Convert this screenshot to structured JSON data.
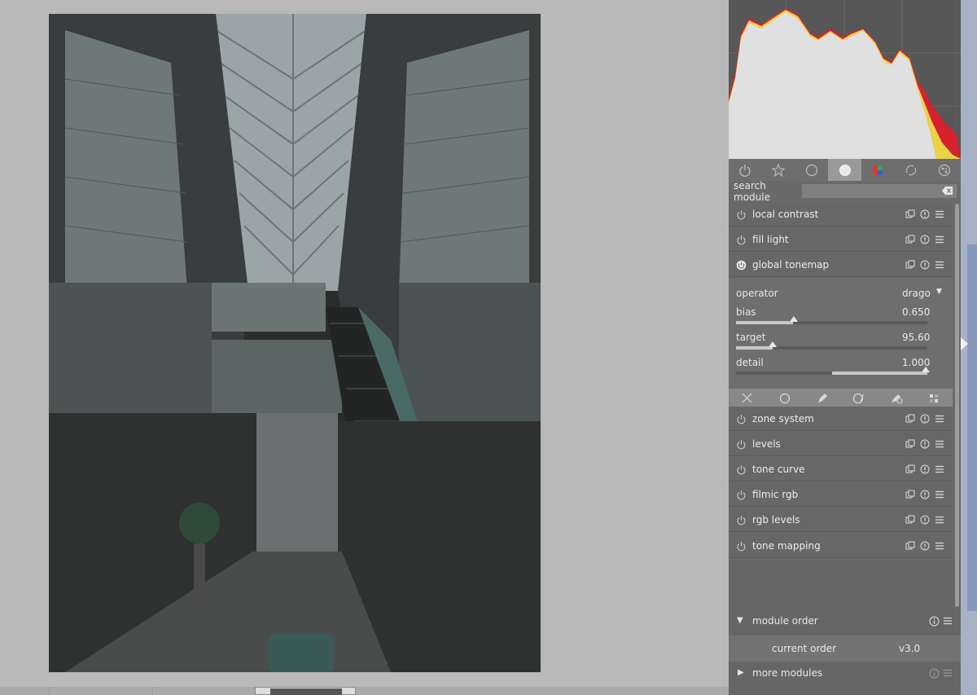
{
  "module_search": {
    "label": "search module",
    "placeholder": ""
  },
  "tabs": [
    {
      "name": "power-icon"
    },
    {
      "name": "star-icon"
    },
    {
      "name": "circle-icon"
    },
    {
      "name": "tone-icon",
      "active": true
    },
    {
      "name": "color-icon"
    },
    {
      "name": "correct-icon"
    },
    {
      "name": "effect-icon"
    }
  ],
  "modules_top": [
    {
      "label": "local contrast"
    },
    {
      "label": "fill light"
    },
    {
      "label": "global tonemap"
    }
  ],
  "global_tonemap": {
    "operator_label": "operator",
    "operator_value": "drago",
    "bias_label": "bias",
    "bias_value": "0.650",
    "bias_fraction": 0.3,
    "target_label": "target",
    "target_value": "95.60",
    "target_fraction": 0.19,
    "detail_label": "detail",
    "detail_value": "1.000",
    "detail_fraction": 0.5
  },
  "modules_bottom": [
    {
      "label": "zone system"
    },
    {
      "label": "levels"
    },
    {
      "label": "tone curve"
    },
    {
      "label": "filmic rgb"
    },
    {
      "label": "rgb levels"
    },
    {
      "label": "tone mapping"
    }
  ],
  "module_order": {
    "label": "module order",
    "current_label": "current order",
    "current_value": "v3.0"
  },
  "more_modules": {
    "label": "more modules"
  },
  "colors": {
    "panel_bg": "#6a6a6a",
    "center_bg": "#b9b9b9",
    "active_tab": "#9a9a9a"
  }
}
